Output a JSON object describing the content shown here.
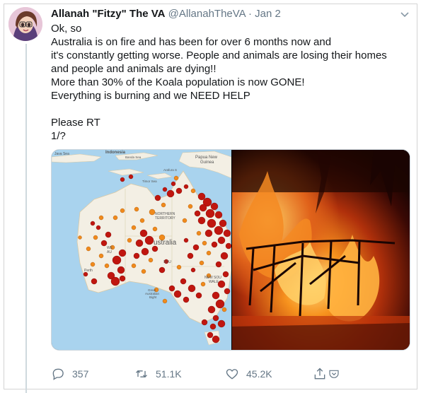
{
  "tweet": {
    "display_name": "Allanah \"Fitzy\" The VA",
    "handle": "@AllanahTheVA",
    "separator": "·",
    "date": "Jan 2",
    "lines": [
      "Ok, so",
      "Australia is on fire and has been for over 6 months now and",
      "it's constantly getting worse. People and animals are losing their homes",
      "and people and animals are dying!!",
      "More than 30% of the Koala population is now GONE!",
      "Everything is burning and we NEED HELP",
      "",
      "Please RT",
      "1/?"
    ]
  },
  "map": {
    "labels": {
      "indonesia": "Indonesia",
      "java_sea": "Java Sea",
      "banda_sea": "Banda Sea",
      "papua": "Papua New",
      "guinea": "Guinea",
      "arafura": "Arafura S",
      "timor_sea": "Timor Sea",
      "northern": "NORTHERN",
      "territory": "TERRITORY",
      "australia": "ustralia",
      "wa_1": "WE",
      "wa_2": "AU",
      "perth": "Perth",
      "sa": "SOU",
      "nsw_1": "NEW SOU",
      "nsw_2": "WALE",
      "bight_1": "Great",
      "bight_2": "Australian",
      "bight_3": "Bight"
    }
  },
  "actions": {
    "replies": "357",
    "retweets": "51.1K",
    "likes": "45.2K"
  },
  "icons": {
    "reply": "reply-icon",
    "retweet": "retweet-icon",
    "like": "heart-icon",
    "share": "share-icon",
    "menu": "chevron-down-icon"
  },
  "colors": {
    "text": "#14171a",
    "muted": "#657786",
    "map_water": "#a9d3ee",
    "map_land": "#f3efe4",
    "fire_red": "#c0160f",
    "fire_orange": "#f08a1b"
  }
}
